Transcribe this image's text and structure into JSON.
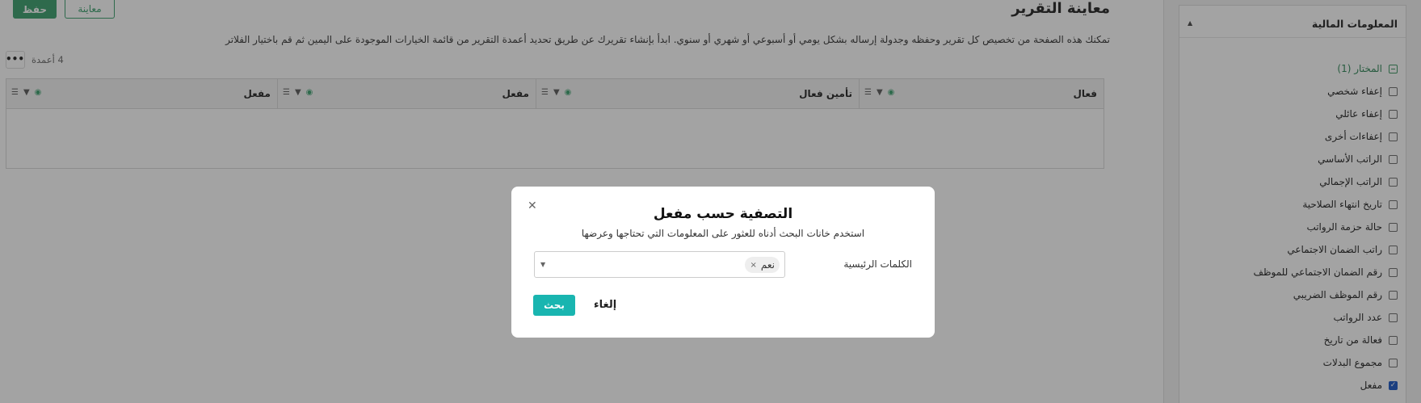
{
  "header": {
    "title": "معاينة التقرير",
    "save_label": "حفظ",
    "preview_label": "معاينة",
    "description": "تمكنك هذه الصفحة من تخصيص كل تقرير وحفظه وجدولة إرساله بشكل يومي أو أسبوعي أو شهري أو سنوي. ابدأ بإنشاء تقريرك عن طريق تحديد أعمدة التقرير من قائمة الخيارات الموجودة على اليمين ثم قم باختيار الفلاتر"
  },
  "toolbar": {
    "more_label": "•••",
    "column_count": "4 أعمدة"
  },
  "table": {
    "columns": [
      {
        "label": "فعال"
      },
      {
        "label": "تأمين فعال"
      },
      {
        "label": "مفعل"
      },
      {
        "label": "مفعل"
      }
    ]
  },
  "sidebar": {
    "title": "المعلومات المالية",
    "items": [
      {
        "label": "المختار (1)",
        "state": "minus"
      },
      {
        "label": "إعفاء شخصي",
        "state": "off"
      },
      {
        "label": "إعفاء عائلي",
        "state": "off"
      },
      {
        "label": "إعفاءات أخرى",
        "state": "off"
      },
      {
        "label": "الراتب الأساسي",
        "state": "off"
      },
      {
        "label": "الراتب الإجمالي",
        "state": "off"
      },
      {
        "label": "تاريخ انتهاء الصلاحية",
        "state": "off"
      },
      {
        "label": "حالة حزمة الرواتب",
        "state": "off"
      },
      {
        "label": "راتب الضمان الاجتماعي",
        "state": "off"
      },
      {
        "label": "رقم الضمان الاجتماعي للموظف",
        "state": "off"
      },
      {
        "label": "رقم الموظف الضريبي",
        "state": "off"
      },
      {
        "label": "عدد الرواتب",
        "state": "off"
      },
      {
        "label": "فعالة من تاريخ",
        "state": "off"
      },
      {
        "label": "مجموع البدلات",
        "state": "off"
      },
      {
        "label": "مفعل",
        "state": "checked"
      }
    ]
  },
  "modal": {
    "title": "التصفية حسب مفعل",
    "subtitle": "استخدم خانات البحث أدناه للعثور على المعلومات التي تحتاجها وعرضها",
    "keywords_label": "الكلمات الرئيسية",
    "tag": "نعم",
    "search_label": "بحث",
    "cancel_label": "إلغاء"
  },
  "colors": {
    "primary_green": "#48a778",
    "search_teal": "#19b5b0",
    "checkbox_blue": "#2b63c9"
  }
}
